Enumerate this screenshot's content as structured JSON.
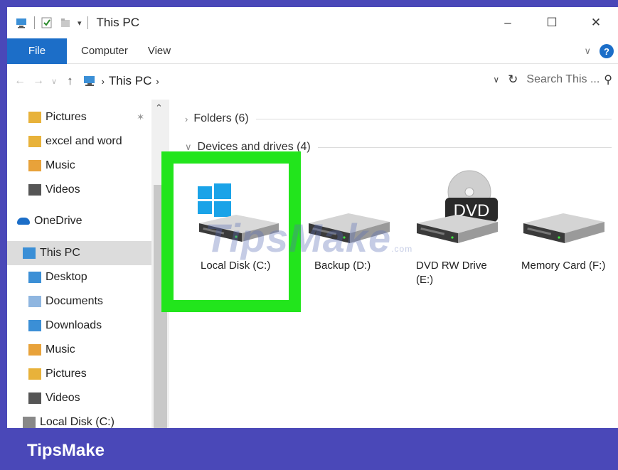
{
  "window": {
    "title": "This PC",
    "controls": {
      "minimize": "–",
      "maximize": "☐",
      "close": "✕"
    }
  },
  "ribbon": {
    "tabs": [
      "File",
      "Computer",
      "View"
    ],
    "help": "?"
  },
  "address": {
    "crumb": "This PC",
    "search_placeholder": "Search This ..."
  },
  "nav": {
    "items": [
      {
        "label": "Pictures",
        "icon": "pictures-folder-icon",
        "pinned": true
      },
      {
        "label": "excel and word",
        "icon": "folder-icon"
      },
      {
        "label": "Music",
        "icon": "music-folder-icon"
      },
      {
        "label": "Videos",
        "icon": "videos-folder-icon"
      },
      {
        "label": "OneDrive",
        "icon": "onedrive-icon"
      },
      {
        "label": "This PC",
        "icon": "this-pc-icon",
        "selected": true
      },
      {
        "label": "Desktop",
        "icon": "desktop-folder-icon"
      },
      {
        "label": "Documents",
        "icon": "documents-folder-icon"
      },
      {
        "label": "Downloads",
        "icon": "downloads-folder-icon"
      },
      {
        "label": "Music",
        "icon": "music-folder-icon"
      },
      {
        "label": "Pictures",
        "icon": "pictures-folder-icon"
      },
      {
        "label": "Videos",
        "icon": "videos-folder-icon"
      },
      {
        "label": "Local Disk (C:)",
        "icon": "local-disk-icon"
      }
    ]
  },
  "content": {
    "folders_header": "Folders (6)",
    "devices_header": "Devices and drives (4)",
    "drives": [
      {
        "label": "Local Disk (C:)",
        "icon": "windows-drive-icon"
      },
      {
        "label": "Backup (D:)",
        "icon": "hard-drive-icon"
      },
      {
        "label": "DVD RW Drive (E:)",
        "icon": "dvd-drive-icon",
        "badge": "DVD"
      },
      {
        "label": "Memory Card (F:)",
        "icon": "hard-drive-icon"
      }
    ]
  },
  "watermark": {
    "text": "TipsMake",
    "suffix": ".com"
  },
  "footer": {
    "brand": "TipsMake"
  },
  "colors": {
    "accent": "#1c6ec8",
    "highlight": "#22e51c",
    "frame": "#4a48b8"
  }
}
